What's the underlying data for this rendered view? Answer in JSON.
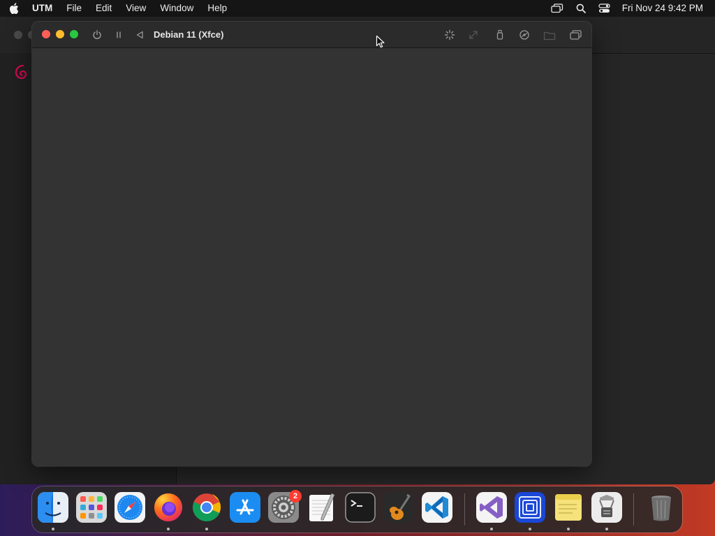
{
  "menubar": {
    "apple_icon": "apple-logo-icon",
    "app_name": "UTM",
    "items": [
      "File",
      "Edit",
      "View",
      "Window",
      "Help"
    ],
    "clock": "Fri Nov 24  9:42 PM",
    "status_icons": [
      "screen-mirroring-icon",
      "spotlight-search-icon",
      "control-center-icon"
    ]
  },
  "vm_window": {
    "title": "Debian 11 (Xfce)",
    "toolbar_icons": [
      "power-icon",
      "pause-icon",
      "back-icon",
      "display-icon",
      "resize-icon",
      "usb-icon",
      "drives-icon",
      "shared-folder-icon",
      "windows-icon"
    ]
  },
  "dock": {
    "apps": [
      "Finder",
      "Launchpad",
      "Safari",
      "Firefox",
      "Google Chrome",
      "App Store",
      "System Settings",
      "TextEdit",
      "Terminal",
      "GarageBand",
      "Visual Studio Code",
      "Visual Studio",
      "UTM",
      "Stickies",
      "Archive Utility",
      "Trash"
    ],
    "system_settings_badge": "2"
  },
  "colors": {
    "close": "#ff5f57",
    "minimize": "#febc2e",
    "maximize": "#28c840",
    "badge": "#ff3b30"
  }
}
